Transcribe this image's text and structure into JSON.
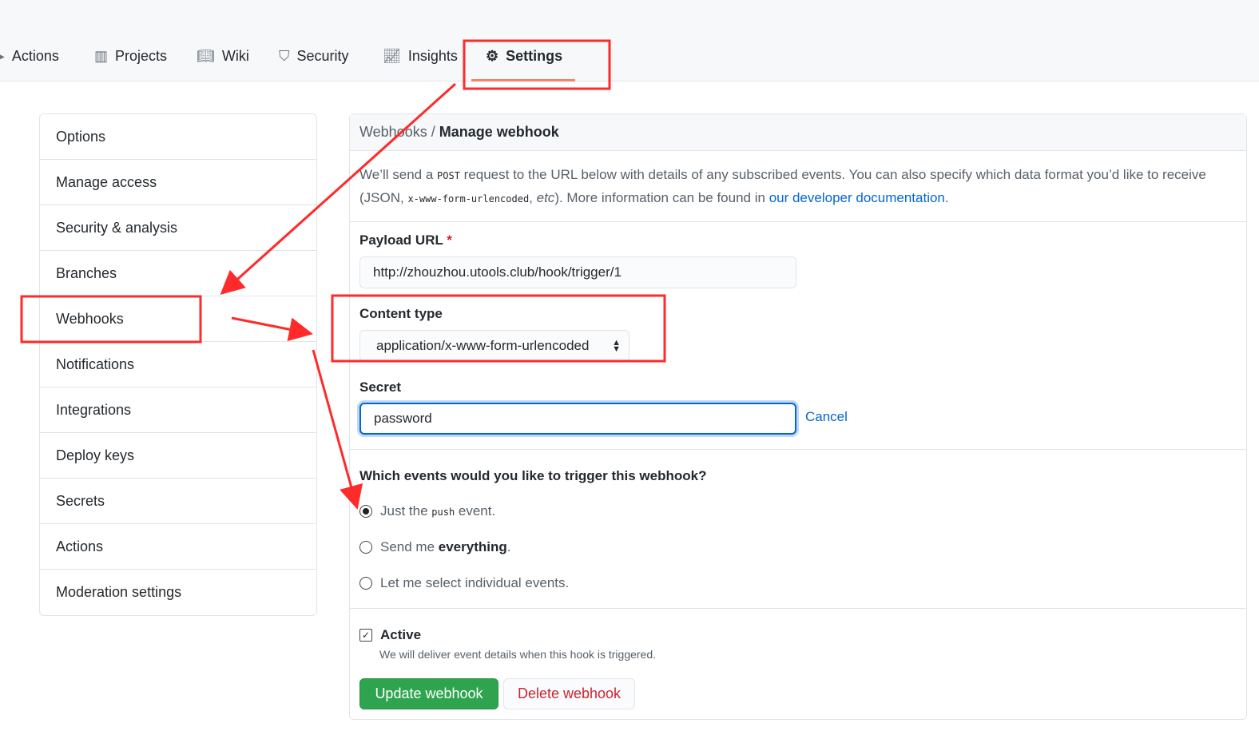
{
  "nav": {
    "tabs": [
      {
        "label": "Actions",
        "icon": "play-icon"
      },
      {
        "label": "Projects",
        "icon": "project-icon"
      },
      {
        "label": "Wiki",
        "icon": "book-icon"
      },
      {
        "label": "Security",
        "icon": "shield-icon"
      },
      {
        "label": "Insights",
        "icon": "graph-icon"
      },
      {
        "label": "Settings",
        "icon": "gear-icon",
        "selected": true
      }
    ]
  },
  "sidebar": {
    "items": [
      {
        "label": "Options"
      },
      {
        "label": "Manage access"
      },
      {
        "label": "Security & analysis"
      },
      {
        "label": "Branches"
      },
      {
        "label": "Webhooks",
        "selected": true
      },
      {
        "label": "Notifications"
      },
      {
        "label": "Integrations"
      },
      {
        "label": "Deploy keys"
      },
      {
        "label": "Secrets"
      },
      {
        "label": "Actions"
      },
      {
        "label": "Moderation settings"
      }
    ]
  },
  "main": {
    "breadcrumb": "Webhooks",
    "sep": " / ",
    "title": "Manage webhook",
    "desc": {
      "p1": "We’ll send a ",
      "code1": "POST",
      "p2": " request to the URL below with details of any subscribed events. You can also specify which data format you’d like to receive (JSON, ",
      "code2": "x-www-form-urlencoded",
      "p3": ", ",
      "etc": "etc",
      "p4": "). More information can be found in ",
      "link": "our developer documentation",
      "p5": "."
    },
    "payload_label": "Payload URL",
    "required": "*",
    "payload_value": "http://zhouzhou.utools.club/hook/trigger/1",
    "content_type_label": "Content type",
    "content_type_value": "application/x-www-form-urlencoded",
    "secret_label": "Secret",
    "secret_value": "password",
    "cancel": "Cancel",
    "events_question": "Which events would you like to trigger this webhook?",
    "radio1": {
      "a": "Just the ",
      "code": "push",
      "b": " event.",
      "checked": true
    },
    "radio2": {
      "a": "Send me ",
      "b": "everything",
      "c": ".",
      "checked": false
    },
    "radio3": {
      "label": "Let me select individual events.",
      "checked": false
    },
    "active_label": "Active",
    "active_checked": true,
    "active_note": "We will deliver event details when this hook is triggered.",
    "update": "Update webhook",
    "delete": "Delete webhook"
  },
  "colors": {
    "annotation": "#ff2a2a",
    "primary": "#2ea44f",
    "danger": "#cb2431",
    "link": "#0366d6",
    "tab_underline": "#f9826c"
  }
}
